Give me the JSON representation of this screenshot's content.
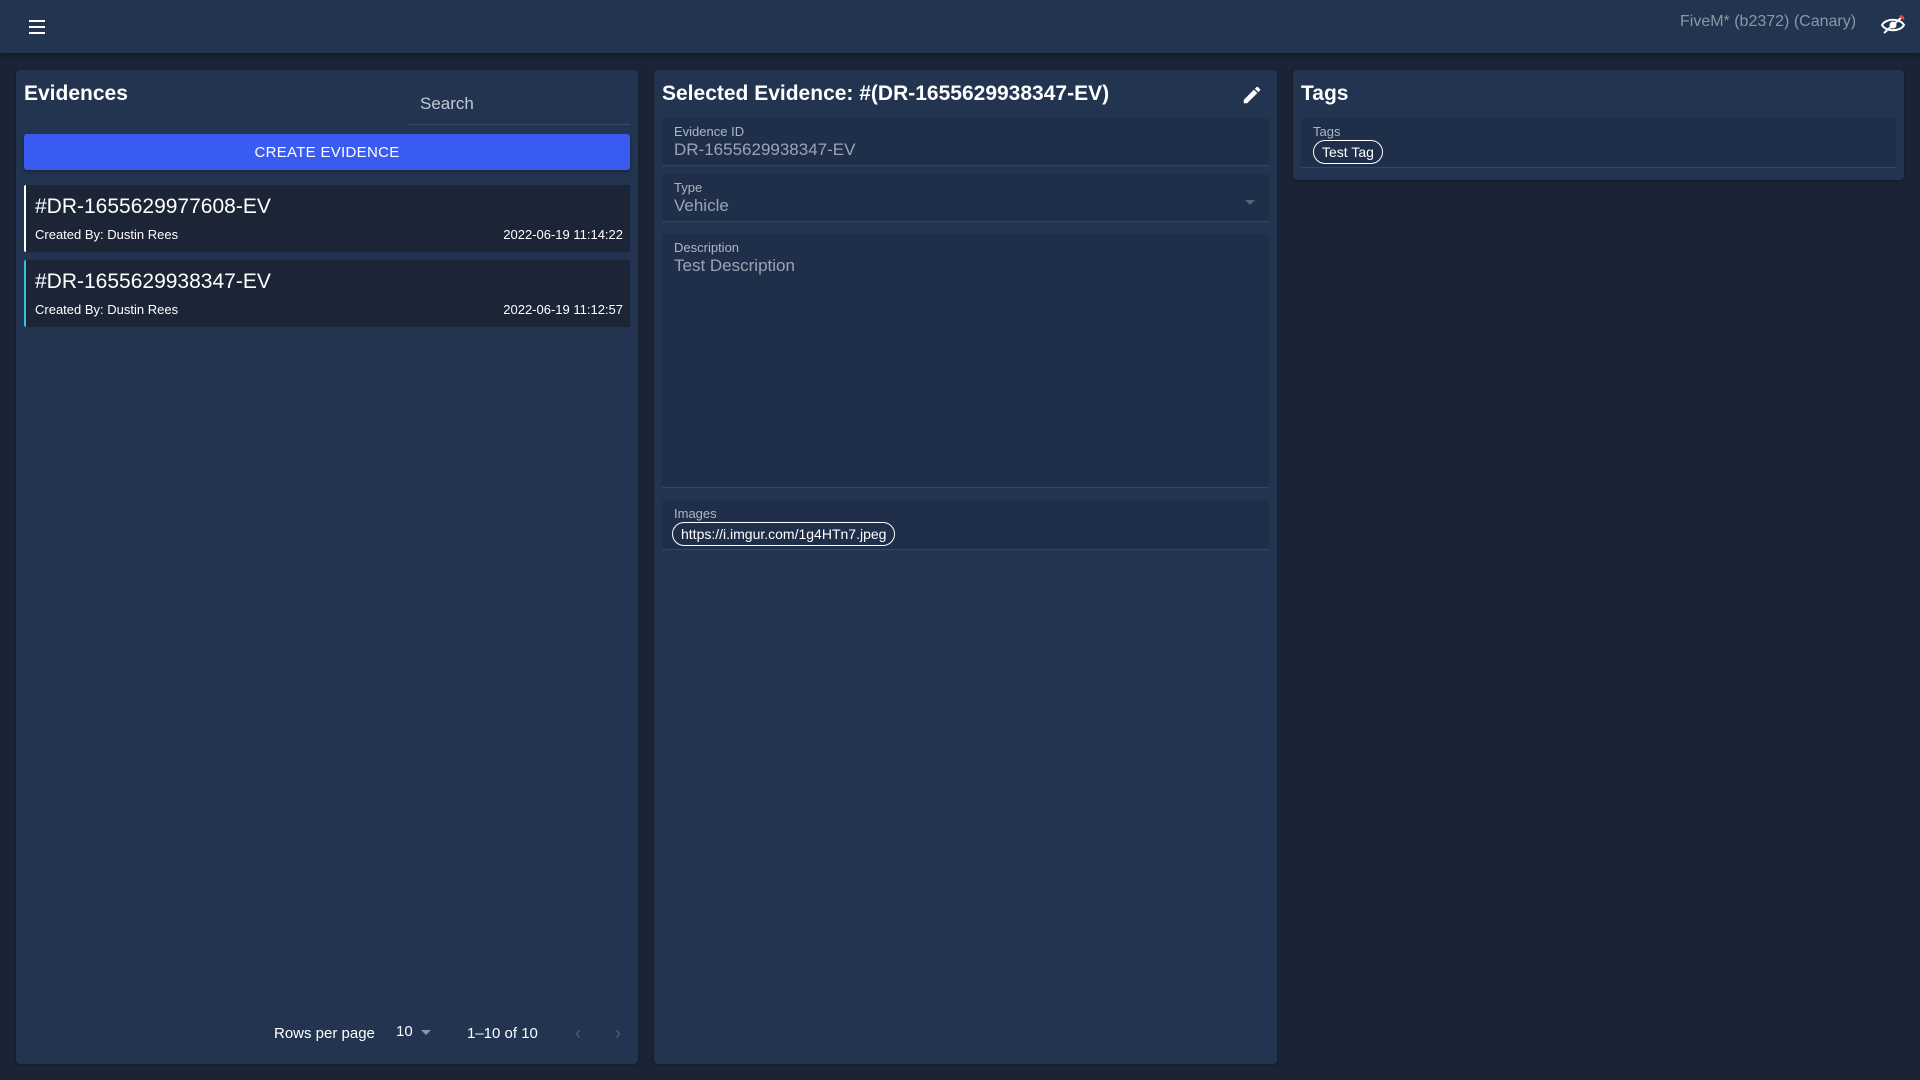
{
  "topbar": {
    "title": "FiveM* (b2372) (Canary)",
    "menu_icon": "hamburger-menu-icon",
    "eye_icon": "eye-off-icon"
  },
  "evidences_panel": {
    "title": "Evidences",
    "search_placeholder": "Search",
    "create_button_label": "CREATE EVIDENCE",
    "items": [
      {
        "id": "#DR-1655629977608-EV",
        "created_by": "Created By: Dustin Rees",
        "date": "2022-06-19 11:14:22",
        "selected": false
      },
      {
        "id": "#DR-1655629938347-EV",
        "created_by": "Created By: Dustin Rees",
        "date": "2022-06-19 11:12:57",
        "selected": true
      }
    ],
    "pagination": {
      "rows_per_page_label": "Rows per page",
      "rows_per_page_value": "10",
      "range": "1–10 of 10",
      "prev_icon": "chevron-left-icon",
      "next_icon": "chevron-right-icon"
    }
  },
  "selected_panel": {
    "title": "Selected Evidence: #(DR-1655629938347-EV)",
    "edit_icon": "pencil-icon",
    "evidence_id": {
      "label": "Evidence ID",
      "value": "DR-1655629938347-EV"
    },
    "type": {
      "label": "Type",
      "value": "Vehicle"
    },
    "description": {
      "label": "Description",
      "value": "Test Description"
    },
    "images": {
      "label": "Images",
      "chips": [
        "https://i.imgur.com/1g4HTn7.jpeg"
      ]
    }
  },
  "tags_panel": {
    "title": "Tags",
    "tags": {
      "label": "Tags",
      "chips": [
        "Test Tag"
      ]
    }
  },
  "colors": {
    "background": "#1a2436",
    "panel": "#223450",
    "accent": "#3a5bf0",
    "selected_indicator": "#2cc4d8"
  }
}
